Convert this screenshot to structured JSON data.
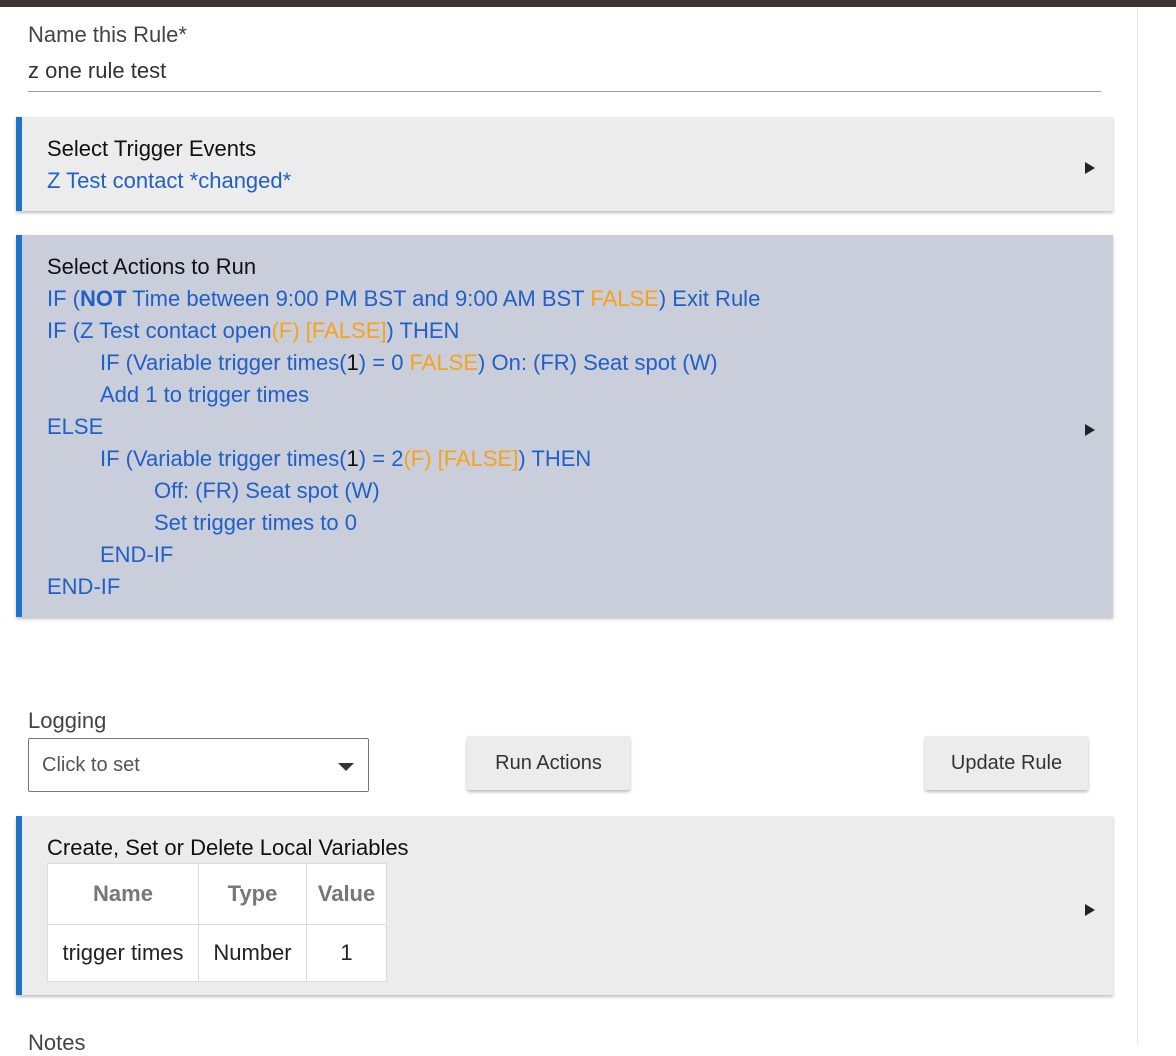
{
  "name_rule": {
    "label": "Name this Rule*",
    "value": "z one rule test"
  },
  "trigger": {
    "title": "Select Trigger Events",
    "summary": "Z Test contact *changed*"
  },
  "actions": {
    "title": "Select Actions to Run",
    "l1": {
      "a": "IF (",
      "b": "NOT",
      "c": " Time between 9:00 PM BST and 9:00 AM BST ",
      "d": "FALSE",
      "e": ") Exit Rule"
    },
    "l2": {
      "a": "IF (Z Test contact open",
      "b": "(F) [FALSE]",
      "c": ") THEN"
    },
    "l3": {
      "a": "IF (Variable trigger times(",
      "b": "1",
      "c": ") = 0 ",
      "d": "FALSE",
      "e": ") On: (FR) Seat spot (W)"
    },
    "l4": "Add 1 to trigger times",
    "l5": "ELSE",
    "l6": {
      "a": "IF (Variable trigger times(",
      "b": "1",
      "c": ") = 2",
      "d": "(F) [FALSE]",
      "e": ") THEN"
    },
    "l7": "Off: (FR) Seat spot (W)",
    "l8": "Set trigger times to 0",
    "l9": "END-IF",
    "l10": "END-IF"
  },
  "logging": {
    "label": "Logging",
    "placeholder": "Click to set"
  },
  "buttons": {
    "run": "Run Actions",
    "update": "Update Rule"
  },
  "variables": {
    "title": "Create, Set or Delete Local Variables",
    "headers": [
      "Name",
      "Type",
      "Value"
    ],
    "rows": [
      [
        "trigger times",
        "Number",
        "1"
      ]
    ]
  },
  "notes": {
    "label": "Notes"
  },
  "colors": {
    "accent": "#1f74c9",
    "link": "#2060c8",
    "false": "#f7a21b",
    "actions_bg": "#c9ceda"
  }
}
